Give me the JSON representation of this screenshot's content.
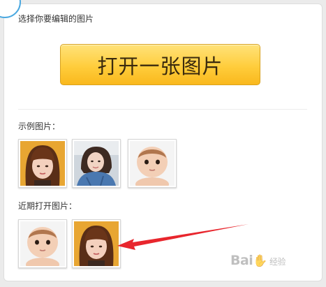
{
  "panel": {
    "title": "选择你要编辑的图片",
    "open_button_label": "打开一张图片"
  },
  "examples": {
    "label": "示例图片：",
    "images": [
      {
        "name": "girl-bangs-portrait"
      },
      {
        "name": "woman-selfie-portrait"
      },
      {
        "name": "baby-portrait"
      }
    ]
  },
  "recent": {
    "label": "近期打开图片：",
    "images": [
      {
        "name": "baby-portrait"
      },
      {
        "name": "girl-bangs-portrait"
      }
    ]
  },
  "annotation": {
    "arrow_color": "#e8262d"
  },
  "watermark": {
    "brand": "Bai",
    "suffix": "经验"
  }
}
